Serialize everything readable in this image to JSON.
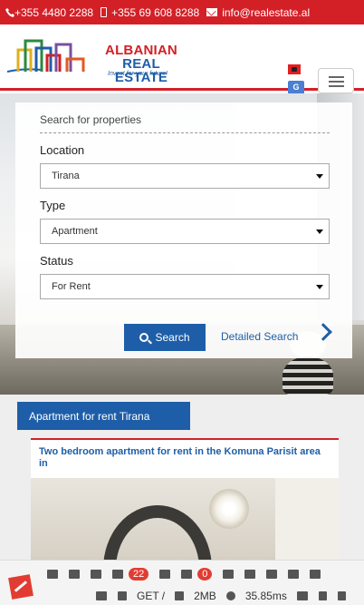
{
  "contact": {
    "phone": "+355 4480 2288",
    "mobile": "+355 69 608 8288",
    "email": "info@realestate.al"
  },
  "brand": {
    "line1": "ALBANIAN",
    "line2": "REAL ESTATE",
    "tagline": "Invest for your future!",
    "red": "#d32027",
    "blue": "#1e5ea8"
  },
  "header": {
    "language_icon": "albania-flag-icon",
    "translate_icon": "google-translate-icon",
    "menu_icon": "hamburger-menu-icon"
  },
  "search": {
    "title": "Search for properties",
    "location_label": "Location",
    "location_value": "Tirana",
    "type_label": "Type",
    "type_value": "Apartment",
    "status_label": "Status",
    "status_value": "For Rent",
    "search_button": "Search",
    "detailed_link": "Detailed Search"
  },
  "listing": {
    "section_tag": "Apartment for rent Tirana",
    "card_title": "Two bedroom apartment for rent in the Komuna Parisit area in"
  },
  "debugbar": {
    "count1": "22",
    "count2": "0",
    "method": "GET /",
    "memory": "2MB",
    "time": "35.85ms"
  }
}
